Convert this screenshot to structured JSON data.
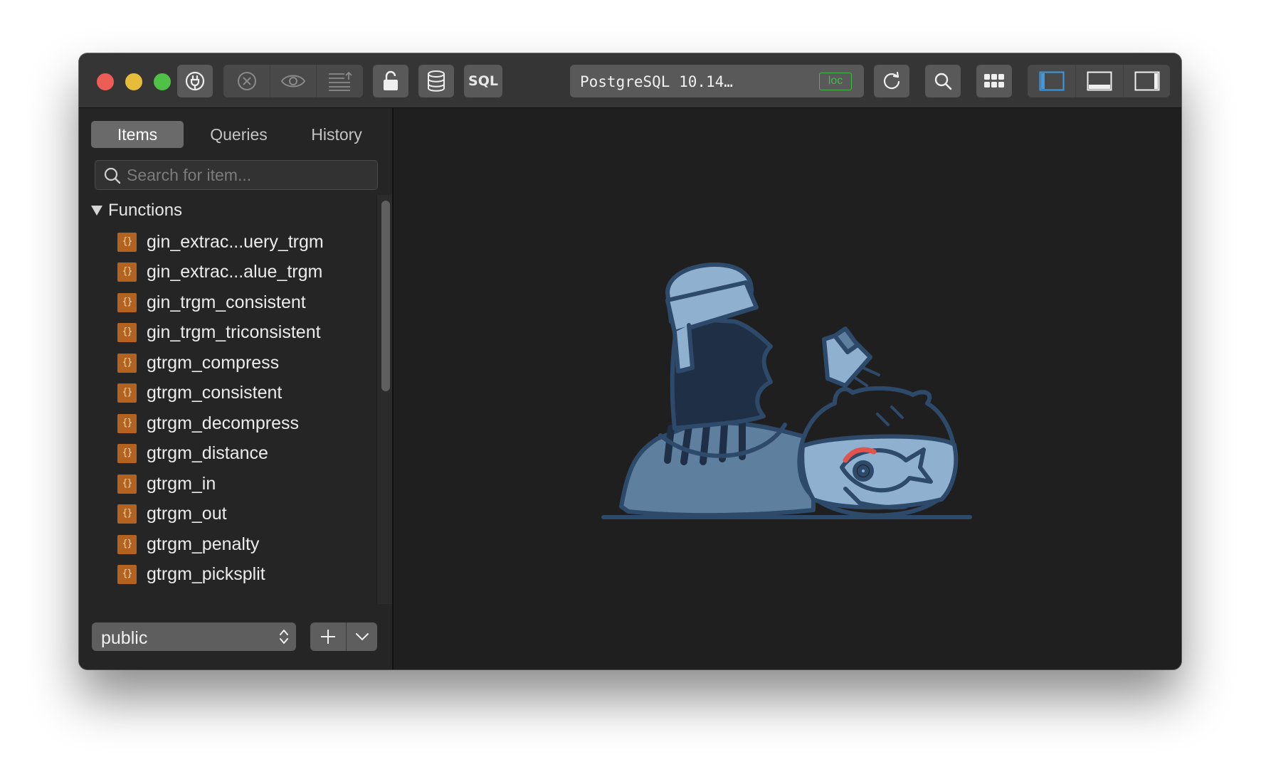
{
  "toolbar": {
    "buttons": [
      {
        "name": "connection-button",
        "icon": "plug-icon"
      },
      {
        "name": "stop-query-button",
        "icon": "close-circle-icon"
      },
      {
        "name": "preview-button",
        "icon": "eye-icon"
      },
      {
        "name": "commit-changes-button",
        "icon": "upload-lines-icon"
      },
      {
        "name": "lock-button",
        "icon": "lock-icon"
      },
      {
        "name": "database-button",
        "icon": "database-icon"
      },
      {
        "name": "refresh-button",
        "icon": "refresh-icon"
      },
      {
        "name": "search-button",
        "icon": "search-icon"
      },
      {
        "name": "apps-button",
        "icon": "grid-icon"
      },
      {
        "name": "toggle-left-panel-button",
        "icon": "left-panel-icon"
      },
      {
        "name": "toggle-bottom-panel-button",
        "icon": "bottom-panel-icon"
      },
      {
        "name": "toggle-right-panel-button",
        "icon": "right-panel-icon"
      }
    ],
    "sql_label": "SQL",
    "connection": {
      "label": "PostgreSQL 10.14…",
      "badge": "loc",
      "badge_color": "#44b94a"
    }
  },
  "sidebar": {
    "tabs": [
      {
        "label": "Items",
        "active": true
      },
      {
        "label": "Queries",
        "active": false
      },
      {
        "label": "History",
        "active": false
      }
    ],
    "search": {
      "placeholder": "Search for item...",
      "value": ""
    },
    "group": {
      "label": "Functions",
      "expanded": true
    },
    "functions": [
      "gin_extrac...uery_trgm",
      "gin_extrac...alue_trgm",
      "gin_trgm_consistent",
      "gin_trgm_triconsistent",
      "gtrgm_compress",
      "gtrgm_consistent",
      "gtrgm_decompress",
      "gtrgm_distance",
      "gtrgm_in",
      "gtrgm_out",
      "gtrgm_penalty",
      "gtrgm_picksplit"
    ],
    "function_icon_text": "{}",
    "function_icon_color": "#b3631f",
    "schema": {
      "value": "public"
    },
    "add_button_icon": "plus-icon",
    "add_menu_icon": "chevron-down-icon"
  },
  "main": {
    "illustration": "elephant-with-fishbowl-illustration"
  },
  "colors": {
    "window_bg": "#1f1f20",
    "toolbar_bg": "#353536",
    "accent_blue": "#3b9ae1",
    "illustration_stroke": "#2e4a6b",
    "illustration_fill": "#5f7f9f"
  }
}
